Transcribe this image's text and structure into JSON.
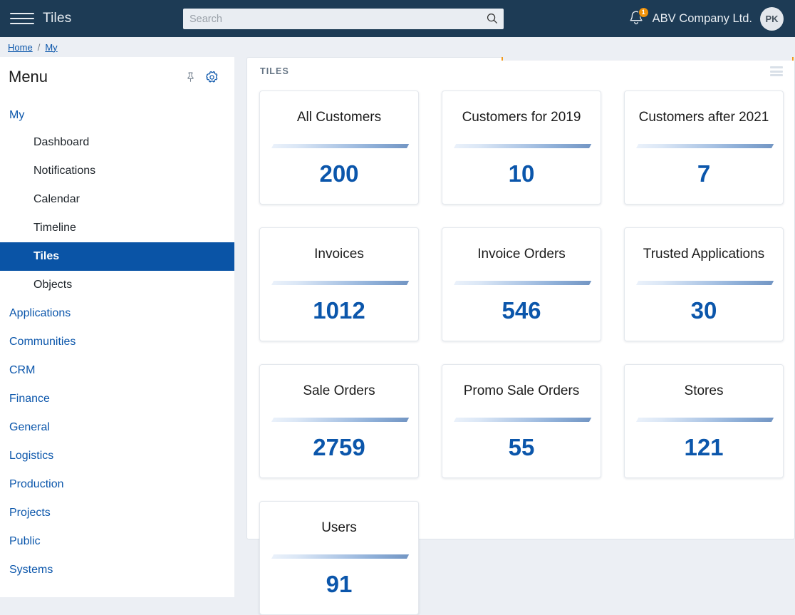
{
  "header": {
    "menu_icon": "hamburger-icon",
    "app_title": "Tiles",
    "search": {
      "placeholder": "Search",
      "value": "",
      "icon": "search-icon"
    },
    "notifications": {
      "icon": "bell-icon",
      "badge_count": "1",
      "badge_color": "#f0920a"
    },
    "company": "ABV Company Ltd.",
    "avatar_initials": "PK"
  },
  "breadcrumb": {
    "items": [
      {
        "label": "Home"
      },
      {
        "label": "My"
      }
    ],
    "separator": "/"
  },
  "sidebar": {
    "title": "Menu",
    "pin_icon": "pin-icon",
    "settings_icon": "gear-icon",
    "group": {
      "label": "My",
      "items": [
        {
          "label": "Dashboard",
          "active": false
        },
        {
          "label": "Notifications",
          "active": false
        },
        {
          "label": "Calendar",
          "active": false
        },
        {
          "label": "Timeline",
          "active": false
        },
        {
          "label": "Tiles",
          "active": true
        },
        {
          "label": "Objects",
          "active": false
        }
      ]
    },
    "categories": [
      {
        "label": "Applications"
      },
      {
        "label": "Communities"
      },
      {
        "label": "CRM"
      },
      {
        "label": "Finance"
      },
      {
        "label": "General"
      },
      {
        "label": "Logistics"
      },
      {
        "label": "Production"
      },
      {
        "label": "Projects"
      },
      {
        "label": "Public"
      },
      {
        "label": "Systems"
      }
    ]
  },
  "panel": {
    "title": "TILES",
    "menu_icon": "panel-menu-icon"
  },
  "tiles": [
    {
      "title": "All Customers",
      "value": "200"
    },
    {
      "title": "Customers for 2019",
      "value": "10"
    },
    {
      "title": "Customers after 2021",
      "value": "7"
    },
    {
      "title": "Invoices",
      "value": "1012"
    },
    {
      "title": "Invoice Orders",
      "value": "546"
    },
    {
      "title": "Trusted Applications",
      "value": "30"
    },
    {
      "title": "Sale Orders",
      "value": "2759"
    },
    {
      "title": "Promo Sale Orders",
      "value": "55"
    },
    {
      "title": "Stores",
      "value": "121"
    },
    {
      "title": "Users",
      "value": "91"
    }
  ],
  "colors": {
    "header_bg": "#1d3b55",
    "page_bg": "#eceff4",
    "accent_blue": "#0b56ab",
    "active_item_bg": "#0a54a6",
    "tab_outline": "#f29a1d"
  }
}
